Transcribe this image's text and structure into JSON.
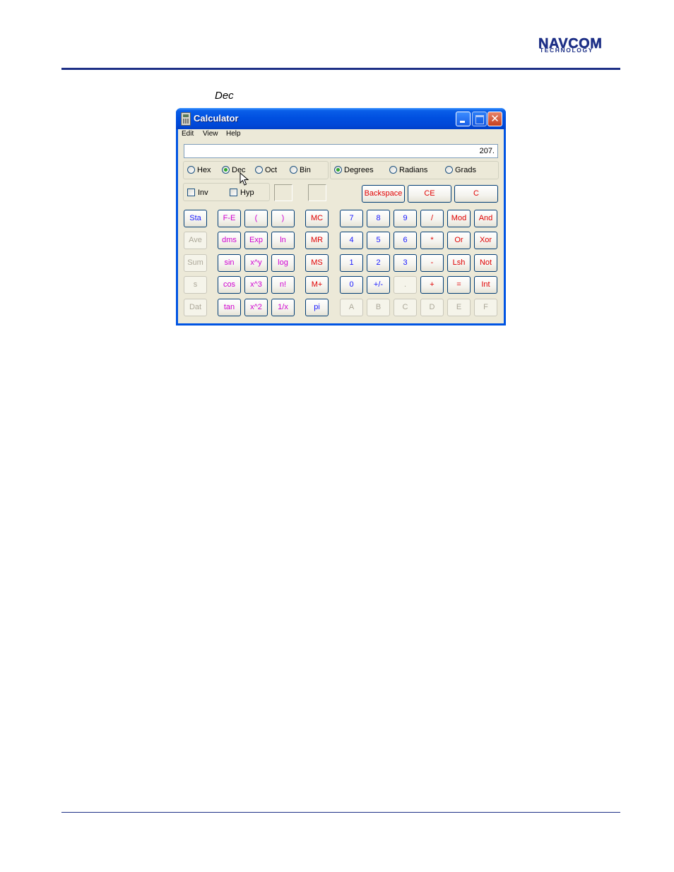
{
  "header": {
    "logo_line1": "NAVCOM",
    "logo_line2": "TECHNOLOGY",
    "brand_color": "#1d2f86"
  },
  "caption": "Dec",
  "window": {
    "title": "Calculator",
    "title_icon": "calculator-icon",
    "controls": {
      "minimize": "minimize-icon",
      "maximize": "maximize-icon",
      "close": "✕"
    },
    "menu": [
      "Edit",
      "View",
      "Help"
    ],
    "display_value": "207.",
    "number_system": [
      {
        "label": "Hex",
        "selected": false
      },
      {
        "label": "Dec",
        "selected": true
      },
      {
        "label": "Oct",
        "selected": false
      },
      {
        "label": "Bin",
        "selected": false
      }
    ],
    "angle_units": [
      {
        "label": "Degrees",
        "selected": true
      },
      {
        "label": "Radians",
        "selected": false
      },
      {
        "label": "Grads",
        "selected": false
      }
    ],
    "checkboxes": [
      {
        "label": "Inv",
        "checked": false
      },
      {
        "label": "Hyp",
        "checked": false
      }
    ],
    "top_buttons": [
      "Backspace",
      "CE",
      "C"
    ],
    "stat_buttons": [
      {
        "label": "Sta",
        "enabled": true
      },
      {
        "label": "Ave",
        "enabled": false
      },
      {
        "label": "Sum",
        "enabled": false
      },
      {
        "label": "s",
        "enabled": false
      },
      {
        "label": "Dat",
        "enabled": false
      }
    ],
    "func_col1": [
      "F-E",
      "dms",
      "sin",
      "cos",
      "tan"
    ],
    "func_col2": [
      "(",
      "Exp",
      "x^y",
      "x^3",
      "x^2"
    ],
    "func_col3": [
      ")",
      "ln",
      "log",
      "n!",
      "1/x"
    ],
    "memory_buttons": [
      "MC",
      "MR",
      "MS",
      "M+",
      "pi"
    ],
    "keypad": [
      [
        "7",
        "8",
        "9",
        "/",
        "Mod",
        "And"
      ],
      [
        "4",
        "5",
        "6",
        "*",
        "Or",
        "Xor"
      ],
      [
        "1",
        "2",
        "3",
        "-",
        "Lsh",
        "Not"
      ],
      [
        "0",
        "+/-",
        ".",
        "+",
        "=",
        "Int"
      ],
      [
        "A",
        "B",
        "C",
        "D",
        "E",
        "F"
      ]
    ],
    "cursor_icon": "mouse-pointer-icon"
  }
}
